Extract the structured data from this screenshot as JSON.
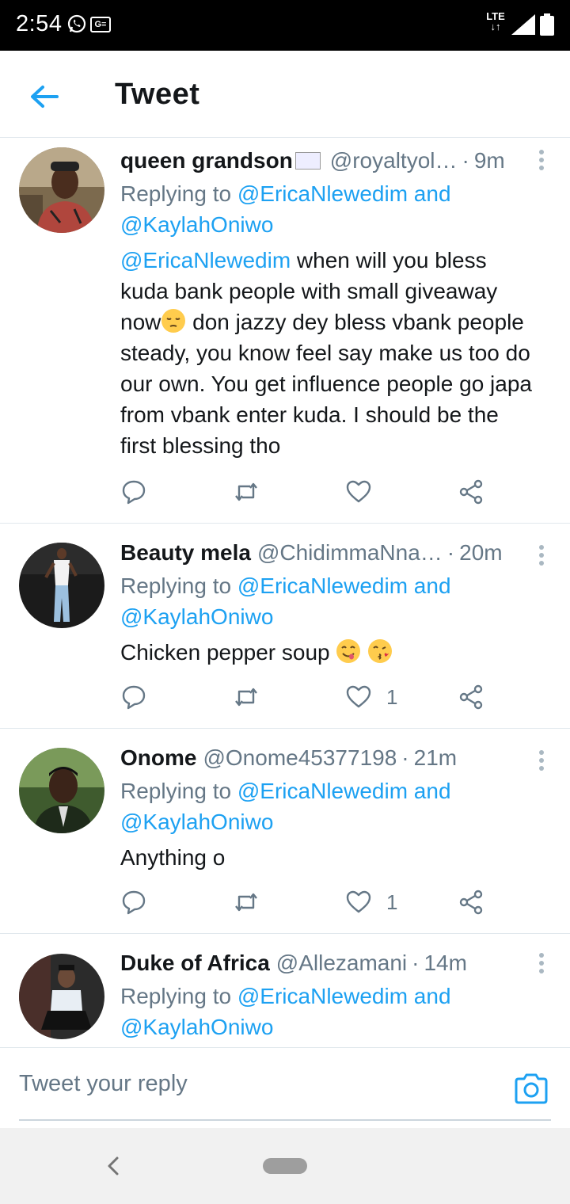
{
  "status_bar": {
    "time": "2:54",
    "network": "LTE",
    "icons": [
      "whatsapp-icon",
      "ge-icon",
      "lte-icon",
      "signal-icon",
      "battery-icon"
    ]
  },
  "app_bar": {
    "title": "Tweet",
    "back_icon": "arrow-left-icon"
  },
  "colors": {
    "accent": "#1da1f2",
    "secondary_text": "#657786",
    "divider": "#e1e8ed"
  },
  "tweets": [
    {
      "name": "queen grandson",
      "handle": "@royaltyol…",
      "time": "9m",
      "replying_prefix": "Replying to ",
      "replying_to": "@EricaNlewedim and @KaylahOniwo",
      "text_mention": "@EricaNlewedim",
      "text_part1": " when will you bless kuda bank people with small giveaway now",
      "text_part2": "  don jazzy dey bless vbank people steady, you know feel say make us too do our own. You get influence people go japa from vbank enter kuda. I should be the first blessing tho",
      "likes": ""
    },
    {
      "name": "Beauty mela",
      "handle": "@ChidimmaNna…",
      "time": "20m",
      "replying_prefix": "Replying to ",
      "replying_to": "@EricaNlewedim and @KaylahOniwo",
      "text": "Chicken pepper soup ",
      "likes": "1"
    },
    {
      "name": "Onome",
      "handle": "@Onome45377198",
      "time": "21m",
      "replying_prefix": "Replying to ",
      "replying_to": "@EricaNlewedim and @KaylahOniwo",
      "text": "Anything o",
      "likes": "1"
    },
    {
      "name": "Duke of Africa",
      "handle": "@Allezamani",
      "time": "14m",
      "replying_prefix": "Replying to ",
      "replying_to": "@EricaNlewedim and @KaylahOniwo"
    }
  ],
  "reply_bar": {
    "placeholder": "Tweet your reply",
    "camera_icon": "camera-icon"
  }
}
